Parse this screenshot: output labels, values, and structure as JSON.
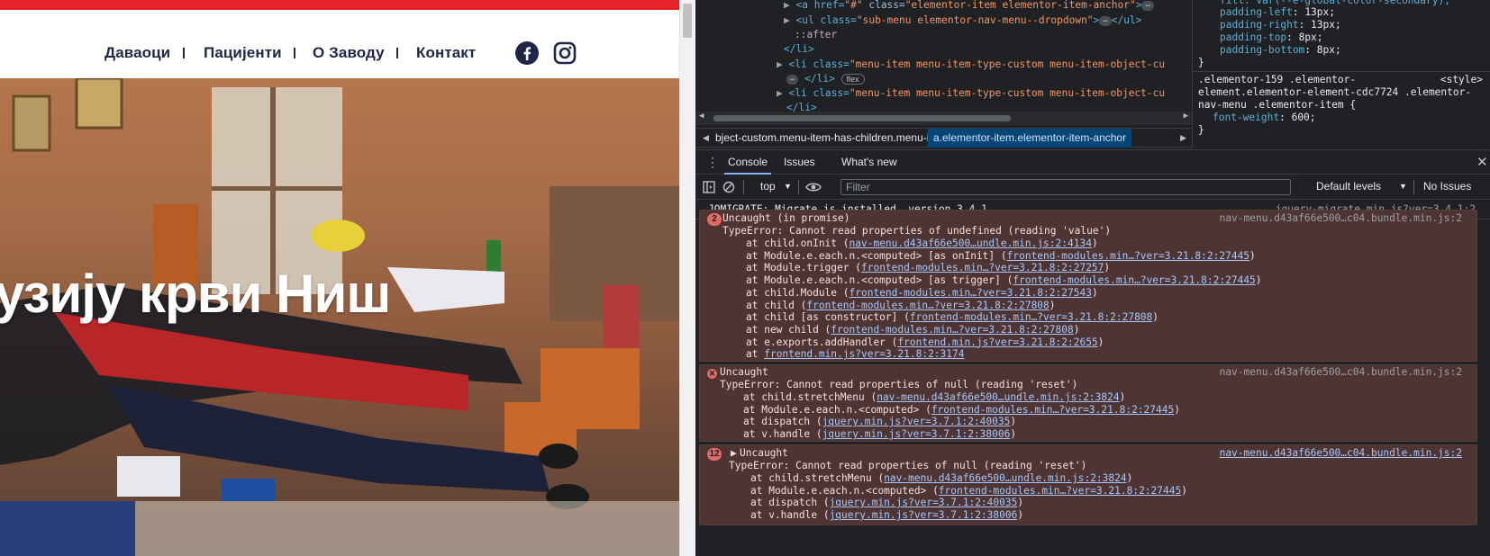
{
  "site": {
    "nav": [
      "Даваоци",
      "Пацијенти",
      "О Заводу",
      "Контакт"
    ],
    "hero_title": "узију крви Ниш",
    "social": [
      "facebook-icon",
      "instagram-icon"
    ],
    "topbar_color": "#e52328"
  },
  "elements": {
    "line1_tag_open": "<a href=",
    "line1_href": "\"#\"",
    "line1_class_attr": " class=",
    "line1_class": "\"elementor-item elementor-item-anchor\"",
    "line1_tag_close": ">",
    "line2_open": "<ul class=",
    "line2_class": "\"sub-menu elementor-nav-menu--dropdown\"",
    "line2_mid": ">",
    "line2_close": "</ul>",
    "line3": "::after",
    "line4": "</li>",
    "line5_open": "<li class=",
    "line5_class": "\"menu-item menu-item-type-custom menu-item-object-cu",
    "line6_close": "</li>",
    "line6_badge": "flex",
    "line7_open": "<li class=",
    "line7_class": "\"menu-item menu-item-type-custom menu-item-object-cu",
    "line8": "</li>"
  },
  "breadcrumbs": {
    "crumb1": "bject-custom.menu-item-has-children.menu-item-173",
    "crumb2": "a.elementor-item.elementor-item-anchor"
  },
  "styles": {
    "l0": "fill: var(--e-global-color-secondary);",
    "l1_prop": "padding-left",
    "l1_val": "13px;",
    "l2_prop": "padding-right",
    "l2_val": "13px;",
    "l3_prop": "padding-top",
    "l3_val": "8px;",
    "l4_prop": "padding-bottom",
    "l4_val": "8px;",
    "l5": "}",
    "l6": ".elementor-159 .elementor-",
    "l6_src": "<style>",
    "l7": "element.elementor-element-cdc7724 .elementor-",
    "l8": "nav-menu .elementor-item {",
    "l9_prop": "font-weight",
    "l9_val": "600;",
    "l10": "}"
  },
  "drawer": {
    "tabs": [
      "Console",
      "Issues",
      "What's new"
    ]
  },
  "toolbar": {
    "context": "top",
    "filter_placeholder": "Filter",
    "levels": "Default levels",
    "issues": "No Issues"
  },
  "console": {
    "msg1": {
      "text": "JQMIGRATE: Migrate is installed, version 3.4.1",
      "source": "jquery-migrate.min.js?ver=3.4.1:2"
    },
    "msg2": {
      "count": "2",
      "title": "Uncaught (in promise)",
      "source": "nav-menu.d43af66e500…c04.bundle.min.js:2",
      "error": "TypeError: Cannot read properties of undefined (reading 'value')",
      "stack": [
        {
          "pre": "at child.onInit (",
          "link": "nav-menu.d43af66e500…undle.min.js:2:4134",
          "post": ")"
        },
        {
          "pre": "at Module.e.each.n.<computed> [as onInit] (",
          "link": "frontend-modules.min…?ver=3.21.8:2:27445",
          "post": ")"
        },
        {
          "pre": "at Module.trigger (",
          "link": "frontend-modules.min…?ver=3.21.8:2:27257",
          "post": ")"
        },
        {
          "pre": "at Module.e.each.n.<computed> [as trigger] (",
          "link": "frontend-modules.min…?ver=3.21.8:2:27445",
          "post": ")"
        },
        {
          "pre": "at child.Module (",
          "link": "frontend-modules.min…?ver=3.21.8:2:27543",
          "post": ")"
        },
        {
          "pre": "at child (",
          "link": "frontend-modules.min…?ver=3.21.8:2:27808",
          "post": ")"
        },
        {
          "pre": "at child [as constructor] (",
          "link": "frontend-modules.min…?ver=3.21.8:2:27808",
          "post": ")"
        },
        {
          "pre": "at new child (",
          "link": "frontend-modules.min…?ver=3.21.8:2:27808",
          "post": ")"
        },
        {
          "pre": "at e.exports.addHandler (",
          "link": "frontend.min.js?ver=3.21.8:2:2655",
          "post": ")"
        },
        {
          "pre": "at ",
          "link": "frontend.min.js?ver=3.21.8:2:3174",
          "post": ""
        }
      ]
    },
    "msg3": {
      "title": "Uncaught",
      "source": "nav-menu.d43af66e500…c04.bundle.min.js:2",
      "error": "TypeError: Cannot read properties of null (reading 'reset')",
      "stack": [
        {
          "pre": "at child.stretchMenu (",
          "link": "nav-menu.d43af66e500…undle.min.js:2:3824",
          "post": ")"
        },
        {
          "pre": "at Module.e.each.n.<computed> (",
          "link": "frontend-modules.min…?ver=3.21.8:2:27445",
          "post": ")"
        },
        {
          "pre": "at dispatch (",
          "link": "jquery.min.js?ver=3.7.1:2:40035",
          "post": ")"
        },
        {
          "pre": "at v.handle (",
          "link": "jquery.min.js?ver=3.7.1:2:38006",
          "post": ")"
        }
      ]
    },
    "msg4": {
      "count": "12",
      "title": "Uncaught",
      "source": "nav-menu.d43af66e500…c04.bundle.min.js:2",
      "error": "TypeError: Cannot read properties of null (reading 'reset')",
      "stack": [
        {
          "pre": "at child.stretchMenu (",
          "link": "nav-menu.d43af66e500…undle.min.js:2:3824",
          "post": ")"
        },
        {
          "pre": "at Module.e.each.n.<computed> (",
          "link": "frontend-modules.min…?ver=3.21.8:2:27445",
          "post": ")"
        },
        {
          "pre": "at dispatch (",
          "link": "jquery.min.js?ver=3.7.1:2:40035",
          "post": ")"
        },
        {
          "pre": "at v.handle (",
          "link": "jquery.min.js?ver=3.7.1:2:38006",
          "post": ")"
        }
      ]
    }
  }
}
